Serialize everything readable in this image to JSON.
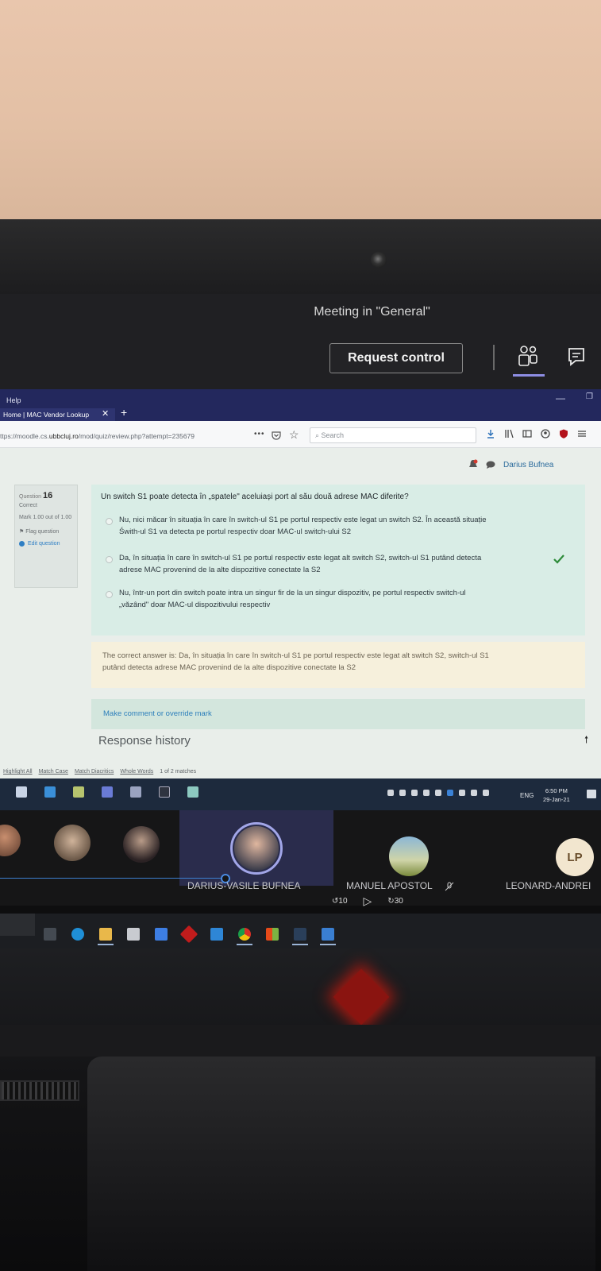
{
  "teams": {
    "meeting_title": "Meeting in \"General\"",
    "request_control_label": "Request control"
  },
  "firefox": {
    "menu_help": "Help",
    "tab_title": "Home | MAC Vendor Lookup",
    "url_prefix": "ttps://moodle.cs.",
    "url_domain": "ubbcluj.ro",
    "url_path": "/mod/quiz/review.php?attempt=235679",
    "search_placeholder": "Search",
    "user_name": "Darius Bufnea"
  },
  "quiz": {
    "question_label": "Question",
    "question_number": "16",
    "status": "Correct",
    "mark": "Mark 1.00 out of 1.00",
    "flag_label": "Flag question",
    "edit_label": "Edit question",
    "question_text": "Un switch S1 poate detecta în „spatele\" aceluiași port al său două adrese MAC diferite?",
    "options": [
      {
        "line1": "Nu, nici măcar în situația în care în switch-ul S1 pe portul respectiv este legat un switch S2. În această situație",
        "line2": "Świth-ul S1 va detecta pe portul respectiv doar MAC-ul switch-ului S2"
      },
      {
        "line1": "Da, în situația în care în switch-ul S1 pe portul respectiv este legat alt switch S2, switch-ul S1 putând detecta",
        "line2": "adrese MAC provenind de la alte dispozitive conectate la S2"
      },
      {
        "line1": "Nu, într-un port din switch poate intra un singur fir de la un singur dispozitiv, pe portul respectiv switch-ul",
        "line2": "„văzând\" doar MAC-ul dispozitivului respectiv"
      }
    ],
    "correct_answer_line1": "The correct answer is: Da, în situația în care în switch-ul S1 pe portul respectiv este legat alt switch S2, switch-ul S1",
    "correct_answer_line2": "putând detecta adrese MAC provenind de la alte dispozitive conectate la S2",
    "comment_link": "Make comment or override mark",
    "response_history": "Response history"
  },
  "findbar": {
    "highlight_all": "Highlight All",
    "match_case": "Match Case",
    "match_diacritics": "Match Diacritics",
    "whole_words": "Whole Words",
    "matches": "1 of 2 matches"
  },
  "remote_taskbar": {
    "language": "ENG",
    "time": "6:50 PM",
    "date": "29-Jan-21"
  },
  "participants": {
    "presenter": "DARIUS-VASILE BUFNEA",
    "p2": "MANUEL APOSTOL",
    "p3": "LEONARD-ANDREI",
    "p3_initials": "LP",
    "skip_back": "10",
    "skip_forward": "30"
  },
  "colors": {
    "teams_bar": "#202023",
    "firefox_title": "#23285d",
    "question_bg": "#d9ede6",
    "answer_bg": "#f6f0dc",
    "accent_purple": "#8d8de3",
    "check_green": "#2e8b3a"
  }
}
